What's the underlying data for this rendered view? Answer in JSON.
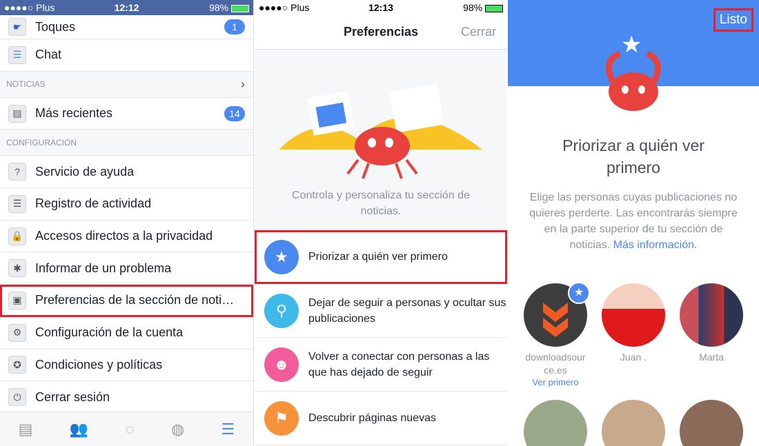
{
  "left": {
    "status": {
      "carrier": "●●●●○ Plus",
      "time": "12:12",
      "battery": "98%"
    },
    "items_top": [
      {
        "label": "Toques",
        "badge": "1",
        "icon": "poke-icon"
      },
      {
        "label": "Chat",
        "icon": "chat-icon"
      }
    ],
    "section_news": "NOTICIAS",
    "news_item": {
      "label": "Más recientes",
      "badge": "14"
    },
    "section_config": "CONFIGURACIÓN",
    "config_items": [
      {
        "label": "Servicio de ayuda",
        "icon": "?"
      },
      {
        "label": "Registro de actividad",
        "icon": "☰"
      },
      {
        "label": "Accesos directos a la privacidad",
        "icon": "🔒"
      },
      {
        "label": "Informar de un problema",
        "icon": "✱"
      },
      {
        "label": "Preferencias de la sección de noti…",
        "icon": "▣"
      },
      {
        "label": "Configuración de la cuenta",
        "icon": "⚙"
      },
      {
        "label": "Condiciones y políticas",
        "icon": "✪"
      },
      {
        "label": "Cerrar sesión",
        "icon": "⏻"
      }
    ],
    "tabs": [
      "news-feed-icon",
      "friends-icon",
      "messenger-icon",
      "globe-icon",
      "menu-icon"
    ]
  },
  "middle": {
    "status": {
      "carrier": "●●●●○ Plus",
      "time": "12:13",
      "battery": "98%"
    },
    "title": "Preferencias",
    "close": "Cerrar",
    "intro": "Controla y personaliza tu sección de noticias.",
    "options": [
      {
        "label": "Priorizar a quién ver primero",
        "color": "#4a89f0",
        "icon": "★"
      },
      {
        "label": "Dejar de seguir a personas y ocultar sus publicaciones",
        "color": "#3fb8ea",
        "icon": "⚲"
      },
      {
        "label": "Volver a conectar con personas a las que has dejado de seguir",
        "color": "#f25c9b",
        "icon": "☻"
      },
      {
        "label": "Descubrir páginas nuevas",
        "color": "#f7923a",
        "icon": "⚑"
      }
    ]
  },
  "right": {
    "done": "Listo",
    "title": "Priorizar a quién ver primero",
    "description": "Elige las personas cuyas publicaciones no quieres perderte. Las encontrarás siempre en la parte superior de tu sección de noticias.",
    "more_link": "Más información.",
    "friends": [
      {
        "name": "downloadsource.es",
        "action": "Ver primero",
        "selected": true
      },
      {
        "name": "Juan ."
      },
      {
        "name": "Marta"
      }
    ]
  }
}
